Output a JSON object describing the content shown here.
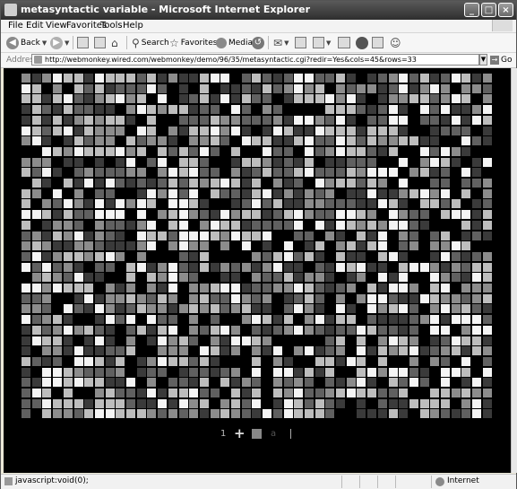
{
  "window": {
    "title": "metasyntactic variable - Microsoft Internet Explorer",
    "controls": {
      "minimize": "_",
      "maximize": "□",
      "close": "×"
    }
  },
  "menu": [
    "File",
    "Edit",
    "View",
    "Favorites",
    "Tools",
    "Help"
  ],
  "toolbar": {
    "back": "Back",
    "search": "Search",
    "favorites": "Favorites",
    "media": "Media"
  },
  "address": {
    "label": "Address",
    "url": "http://webmonkey.wired.com/webmonkey/demo/96/35/metasyntactic.cgi?redir=Yes&cols=45&rows=33",
    "go": "Go"
  },
  "page": {
    "grid": {
      "columns": 45,
      "rows": 33,
      "palette": [
        "#000000",
        "#3a3a3a",
        "#606060",
        "#8c8c8c",
        "#bdbdbd",
        "#f4f4f4"
      ]
    },
    "controls": {
      "page_number": "1",
      "plus": "+",
      "letter": "a"
    }
  },
  "status": {
    "text": "javascript:void(0);",
    "zone": "Internet"
  }
}
